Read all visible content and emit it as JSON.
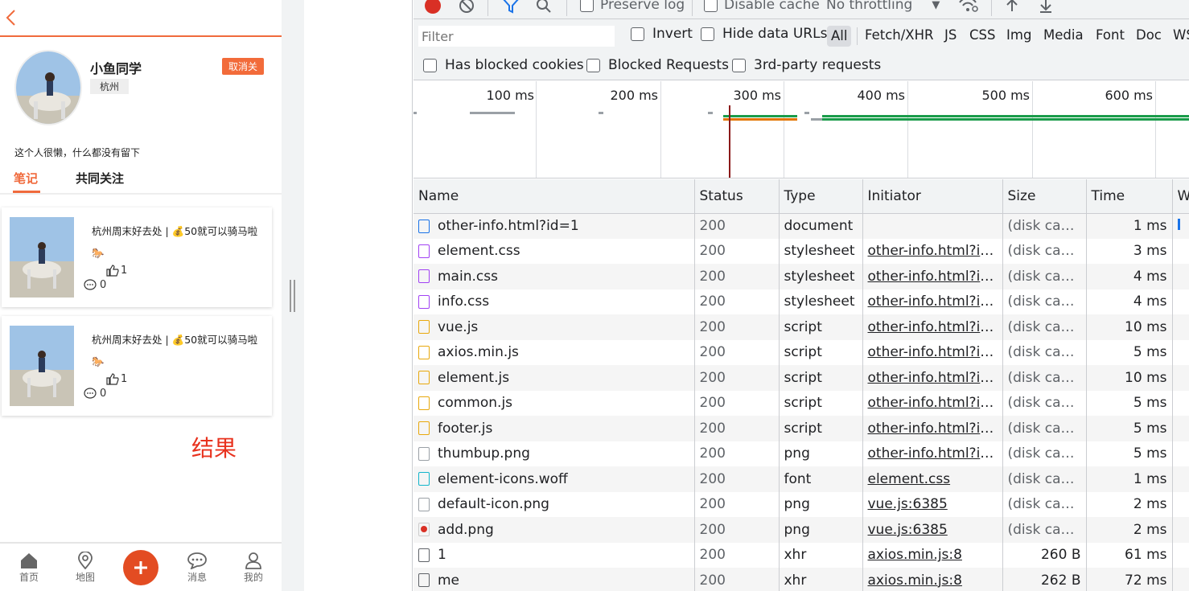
{
  "app": {
    "username": "小鱼同学",
    "city": "杭州",
    "unfollow_label": "取消关",
    "bio": "这个人很懒，什么都没有留下",
    "tabs": [
      "笔记",
      "共同关注"
    ],
    "notes": [
      {
        "title": "杭州周末好去处 | 💰50就可以骑马啦🐎",
        "likes": "1",
        "comments": "0"
      },
      {
        "title": "杭州周末好去处 | 💰50就可以骑马啦🐎",
        "likes": "1",
        "comments": "0"
      }
    ],
    "result_label": "结果",
    "footer": [
      "首页",
      "地图",
      "消息",
      "我的"
    ],
    "accent_color": "#f06a3c"
  },
  "devtools": {
    "toolbar": {
      "preserve_log": "Preserve log",
      "disable_cache": "Disable cache",
      "throttling": "No throttling"
    },
    "filter": {
      "placeholder": "Filter",
      "invert": "Invert",
      "hide_data_urls": "Hide data URLs",
      "types": [
        "All",
        "Fetch/XHR",
        "JS",
        "CSS",
        "Img",
        "Media",
        "Font",
        "Doc",
        "WS"
      ]
    },
    "filter2": {
      "blocked_cookies": "Has blocked cookies",
      "blocked_requests": "Blocked Requests",
      "third_party": "3rd-party requests"
    },
    "overview_labels": [
      "100 ms",
      "200 ms",
      "300 ms",
      "400 ms",
      "500 ms",
      "600 ms"
    ],
    "columns": [
      "Name",
      "Status",
      "Type",
      "Initiator",
      "Size",
      "Time",
      "W"
    ],
    "rows": [
      {
        "name": "other-info.html?id=1",
        "icon": "document-icon",
        "status": "200",
        "type": "document",
        "initiator": "",
        "size": "(disk cac...",
        "time": "1 ms"
      },
      {
        "name": "element.css",
        "icon": "stylesheet-icon",
        "status": "200",
        "type": "stylesheet",
        "initiator": "other-info.html?id...",
        "size": "(disk cac...",
        "time": "3 ms"
      },
      {
        "name": "main.css",
        "icon": "stylesheet-icon",
        "status": "200",
        "type": "stylesheet",
        "initiator": "other-info.html?id...",
        "size": "(disk cac...",
        "time": "4 ms"
      },
      {
        "name": "info.css",
        "icon": "stylesheet-icon",
        "status": "200",
        "type": "stylesheet",
        "initiator": "other-info.html?id...",
        "size": "(disk cac...",
        "time": "4 ms"
      },
      {
        "name": "vue.js",
        "icon": "script-icon",
        "status": "200",
        "type": "script",
        "initiator": "other-info.html?id...",
        "size": "(disk cac...",
        "time": "10 ms"
      },
      {
        "name": "axios.min.js",
        "icon": "script-icon",
        "status": "200",
        "type": "script",
        "initiator": "other-info.html?id...",
        "size": "(disk cac...",
        "time": "5 ms"
      },
      {
        "name": "element.js",
        "icon": "script-icon",
        "status": "200",
        "type": "script",
        "initiator": "other-info.html?id...",
        "size": "(disk cac...",
        "time": "10 ms"
      },
      {
        "name": "common.js",
        "icon": "script-icon",
        "status": "200",
        "type": "script",
        "initiator": "other-info.html?id...",
        "size": "(disk cac...",
        "time": "5 ms"
      },
      {
        "name": "footer.js",
        "icon": "script-icon",
        "status": "200",
        "type": "script",
        "initiator": "other-info.html?id...",
        "size": "(disk cac...",
        "time": "5 ms"
      },
      {
        "name": "thumbup.png",
        "icon": "image-icon",
        "status": "200",
        "type": "png",
        "initiator": "other-info.html?id...",
        "size": "(disk cac...",
        "time": "5 ms"
      },
      {
        "name": "element-icons.woff",
        "icon": "font-icon",
        "status": "200",
        "type": "font",
        "initiator": "element.css",
        "size": "(disk cac...",
        "time": "1 ms"
      },
      {
        "name": "default-icon.png",
        "icon": "image-icon",
        "status": "200",
        "type": "png",
        "initiator": "vue.js:6385",
        "size": "(disk cac...",
        "time": "2 ms"
      },
      {
        "name": "add.png",
        "icon": "add-image-icon",
        "status": "200",
        "type": "png",
        "initiator": "vue.js:6385",
        "size": "(disk cac...",
        "time": "2 ms"
      },
      {
        "name": "1",
        "icon": "xhr-icon",
        "status": "200",
        "type": "xhr",
        "initiator": "axios.min.js:8",
        "size": "260 B",
        "time": "61 ms"
      },
      {
        "name": "me",
        "icon": "xhr-icon",
        "status": "200",
        "type": "xhr",
        "initiator": "axios.min.js:8",
        "size": "262 B",
        "time": "72 ms"
      }
    ]
  }
}
